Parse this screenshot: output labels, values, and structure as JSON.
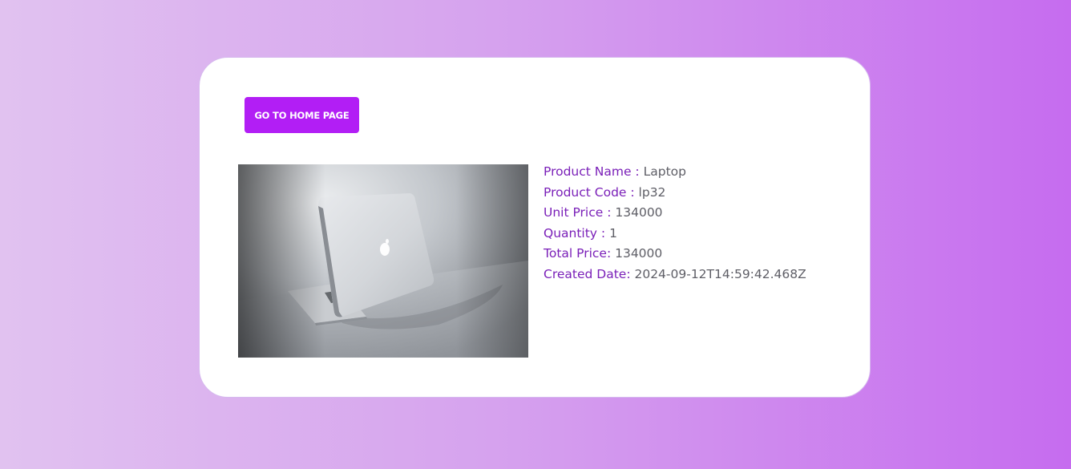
{
  "page": {
    "background_colors": [
      "#e1c2f0",
      "#d6a3ee",
      "#c66cef"
    ]
  },
  "actions": {
    "home_button_label": "GO TO HOME PAGE",
    "home_button_color": "#b21ef5"
  },
  "product": {
    "image_icon": "laptop-photo",
    "details": [
      {
        "label": "Product Name : ",
        "value": "Laptop"
      },
      {
        "label": "Product Code : ",
        "value": "lp32"
      },
      {
        "label": "Unit Price : ",
        "value": "134000"
      },
      {
        "label": "Quantity : ",
        "value": "1"
      },
      {
        "label": "Total Price: ",
        "value": "134000"
      },
      {
        "label": "Created Date: ",
        "value": "2024-09-12T14:59:42.468Z"
      }
    ],
    "label_color": "#7a1fb8",
    "value_color": "#5e5e66"
  }
}
